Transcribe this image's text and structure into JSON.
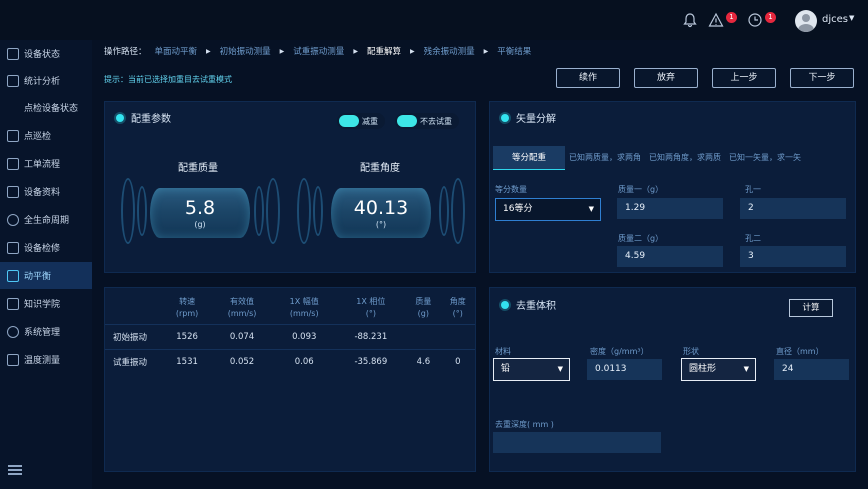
{
  "topbar": {
    "alert_count": "1",
    "clock_count": "1",
    "username": "djces"
  },
  "sidebar": {
    "items": [
      {
        "label": "设备状态",
        "icon": "monitor-icon"
      },
      {
        "label": "统计分析",
        "icon": "bar-chart-icon"
      },
      {
        "label": "点检设备状态",
        "icon": ""
      },
      {
        "label": "点巡检",
        "icon": "route-icon"
      },
      {
        "label": "工单流程",
        "icon": "list-icon"
      },
      {
        "label": "设备资料",
        "icon": "folder-icon"
      },
      {
        "label": "全生命周期",
        "icon": "cycle-icon"
      },
      {
        "label": "设备检修",
        "icon": "wrench-icon"
      },
      {
        "label": "动平衡",
        "icon": "balance-icon"
      },
      {
        "label": "知识学院",
        "icon": "book-icon"
      },
      {
        "label": "系统管理",
        "icon": "gear-icon"
      },
      {
        "label": "温度测量",
        "icon": "thermometer-icon"
      }
    ]
  },
  "breadcrumb": {
    "lead": "操作路径：",
    "steps": [
      "单面动平衡",
      "初始振动测量",
      "试重振动测量",
      "配重解算",
      "残余振动测量",
      "平衡结果"
    ]
  },
  "hint": "提示：当前已选择加重目去试重模式",
  "actions": {
    "finish": "续作",
    "abandon": "放弃",
    "prev": "上一步",
    "next": "下一步"
  },
  "weight_params": {
    "title": "配重参数",
    "toggle1": "减重",
    "toggle2": "不去试重",
    "mass_label": "配重质量",
    "mass_value": "5.8",
    "mass_unit": "(g)",
    "angle_label": "配重角度",
    "angle_value": "40.13",
    "angle_unit": "(°)"
  },
  "vibration_table": {
    "headers": [
      [
        "转速",
        "(rpm)"
      ],
      [
        "有效值",
        "(mm/s)"
      ],
      [
        "1X 幅值",
        "(mm/s)"
      ],
      [
        "1X 相位",
        "(°)"
      ],
      [
        "质量",
        "(g)"
      ],
      [
        "角度",
        "(°)"
      ]
    ],
    "rows": [
      {
        "label": "初始振动",
        "cells": [
          "1526",
          "0.074",
          "0.093",
          "-88.231",
          "",
          ""
        ]
      },
      {
        "label": "试重振动",
        "cells": [
          "1531",
          "0.052",
          "0.06",
          "-35.869",
          "4.6",
          "0"
        ]
      }
    ]
  },
  "vector": {
    "title": "矢量分解",
    "tabs": [
      "等分配重",
      "已知两质量，求两角",
      "已知两角度，求两质",
      "已知一矢量，求一矢"
    ],
    "division_label": "等分数量",
    "division_value": "16等分",
    "mass1_label": "质量一（g）",
    "mass1_value": "1.29",
    "hole1_label": "孔一",
    "hole1_value": "2",
    "mass2_label": "质量二（g）",
    "mass2_value": "4.59",
    "hole2_label": "孔二",
    "hole2_value": "3"
  },
  "removal": {
    "title": "去重体积",
    "calc_label": "计算",
    "material_label": "材料",
    "material_value": "铅",
    "density_label": "密度（g/mm³）",
    "density_value": "0.0113",
    "shape_label": "形状",
    "shape_value": "圆柱形",
    "diameter_label": "直径（mm）",
    "diameter_value": "24",
    "depth_label": "去重深度( mm )",
    "depth_value": ""
  }
}
